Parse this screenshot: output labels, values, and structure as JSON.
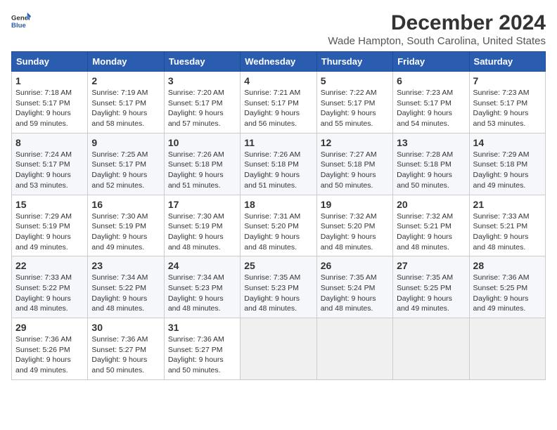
{
  "logo": {
    "general": "General",
    "blue": "Blue"
  },
  "title": "December 2024",
  "subtitle": "Wade Hampton, South Carolina, United States",
  "calendar": {
    "headers": [
      "Sunday",
      "Monday",
      "Tuesday",
      "Wednesday",
      "Thursday",
      "Friday",
      "Saturday"
    ],
    "weeks": [
      [
        {
          "day": "1",
          "info": "Sunrise: 7:18 AM\nSunset: 5:17 PM\nDaylight: 9 hours\nand 59 minutes."
        },
        {
          "day": "2",
          "info": "Sunrise: 7:19 AM\nSunset: 5:17 PM\nDaylight: 9 hours\nand 58 minutes."
        },
        {
          "day": "3",
          "info": "Sunrise: 7:20 AM\nSunset: 5:17 PM\nDaylight: 9 hours\nand 57 minutes."
        },
        {
          "day": "4",
          "info": "Sunrise: 7:21 AM\nSunset: 5:17 PM\nDaylight: 9 hours\nand 56 minutes."
        },
        {
          "day": "5",
          "info": "Sunrise: 7:22 AM\nSunset: 5:17 PM\nDaylight: 9 hours\nand 55 minutes."
        },
        {
          "day": "6",
          "info": "Sunrise: 7:23 AM\nSunset: 5:17 PM\nDaylight: 9 hours\nand 54 minutes."
        },
        {
          "day": "7",
          "info": "Sunrise: 7:23 AM\nSunset: 5:17 PM\nDaylight: 9 hours\nand 53 minutes."
        }
      ],
      [
        {
          "day": "8",
          "info": "Sunrise: 7:24 AM\nSunset: 5:17 PM\nDaylight: 9 hours\nand 53 minutes."
        },
        {
          "day": "9",
          "info": "Sunrise: 7:25 AM\nSunset: 5:17 PM\nDaylight: 9 hours\nand 52 minutes."
        },
        {
          "day": "10",
          "info": "Sunrise: 7:26 AM\nSunset: 5:18 PM\nDaylight: 9 hours\nand 51 minutes."
        },
        {
          "day": "11",
          "info": "Sunrise: 7:26 AM\nSunset: 5:18 PM\nDaylight: 9 hours\nand 51 minutes."
        },
        {
          "day": "12",
          "info": "Sunrise: 7:27 AM\nSunset: 5:18 PM\nDaylight: 9 hours\nand 50 minutes."
        },
        {
          "day": "13",
          "info": "Sunrise: 7:28 AM\nSunset: 5:18 PM\nDaylight: 9 hours\nand 50 minutes."
        },
        {
          "day": "14",
          "info": "Sunrise: 7:29 AM\nSunset: 5:18 PM\nDaylight: 9 hours\nand 49 minutes."
        }
      ],
      [
        {
          "day": "15",
          "info": "Sunrise: 7:29 AM\nSunset: 5:19 PM\nDaylight: 9 hours\nand 49 minutes."
        },
        {
          "day": "16",
          "info": "Sunrise: 7:30 AM\nSunset: 5:19 PM\nDaylight: 9 hours\nand 49 minutes."
        },
        {
          "day": "17",
          "info": "Sunrise: 7:30 AM\nSunset: 5:19 PM\nDaylight: 9 hours\nand 48 minutes."
        },
        {
          "day": "18",
          "info": "Sunrise: 7:31 AM\nSunset: 5:20 PM\nDaylight: 9 hours\nand 48 minutes."
        },
        {
          "day": "19",
          "info": "Sunrise: 7:32 AM\nSunset: 5:20 PM\nDaylight: 9 hours\nand 48 minutes."
        },
        {
          "day": "20",
          "info": "Sunrise: 7:32 AM\nSunset: 5:21 PM\nDaylight: 9 hours\nand 48 minutes."
        },
        {
          "day": "21",
          "info": "Sunrise: 7:33 AM\nSunset: 5:21 PM\nDaylight: 9 hours\nand 48 minutes."
        }
      ],
      [
        {
          "day": "22",
          "info": "Sunrise: 7:33 AM\nSunset: 5:22 PM\nDaylight: 9 hours\nand 48 minutes."
        },
        {
          "day": "23",
          "info": "Sunrise: 7:34 AM\nSunset: 5:22 PM\nDaylight: 9 hours\nand 48 minutes."
        },
        {
          "day": "24",
          "info": "Sunrise: 7:34 AM\nSunset: 5:23 PM\nDaylight: 9 hours\nand 48 minutes."
        },
        {
          "day": "25",
          "info": "Sunrise: 7:35 AM\nSunset: 5:23 PM\nDaylight: 9 hours\nand 48 minutes."
        },
        {
          "day": "26",
          "info": "Sunrise: 7:35 AM\nSunset: 5:24 PM\nDaylight: 9 hours\nand 48 minutes."
        },
        {
          "day": "27",
          "info": "Sunrise: 7:35 AM\nSunset: 5:25 PM\nDaylight: 9 hours\nand 49 minutes."
        },
        {
          "day": "28",
          "info": "Sunrise: 7:36 AM\nSunset: 5:25 PM\nDaylight: 9 hours\nand 49 minutes."
        }
      ],
      [
        {
          "day": "29",
          "info": "Sunrise: 7:36 AM\nSunset: 5:26 PM\nDaylight: 9 hours\nand 49 minutes."
        },
        {
          "day": "30",
          "info": "Sunrise: 7:36 AM\nSunset: 5:27 PM\nDaylight: 9 hours\nand 50 minutes."
        },
        {
          "day": "31",
          "info": "Sunrise: 7:36 AM\nSunset: 5:27 PM\nDaylight: 9 hours\nand 50 minutes."
        },
        {
          "day": "",
          "info": ""
        },
        {
          "day": "",
          "info": ""
        },
        {
          "day": "",
          "info": ""
        },
        {
          "day": "",
          "info": ""
        }
      ]
    ]
  }
}
